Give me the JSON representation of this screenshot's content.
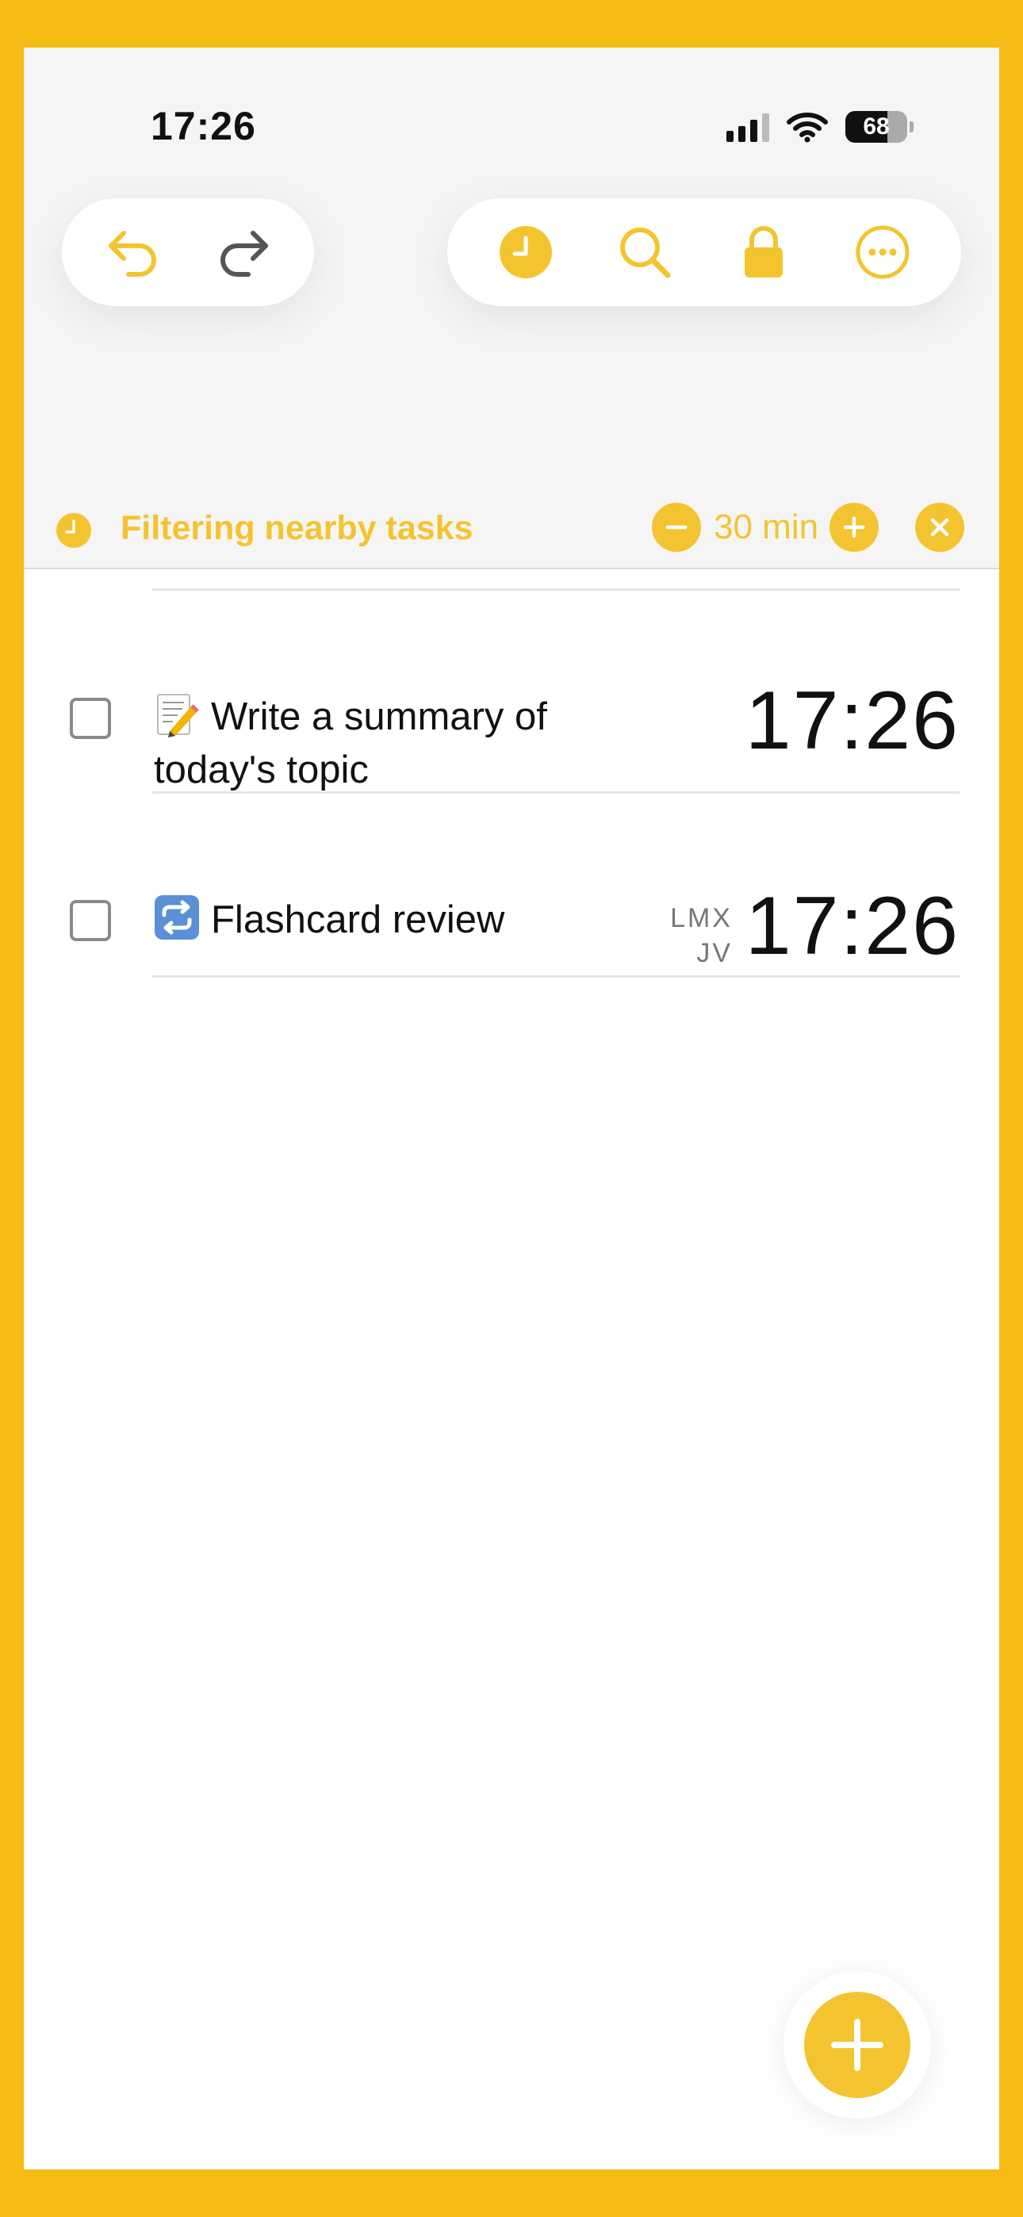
{
  "colors": {
    "accent": "#F4C430",
    "frame": "#F4BC14",
    "text": "#111111",
    "secondary_text": "#777777"
  },
  "status_bar": {
    "time": "17:26",
    "battery": "68",
    "icons": [
      "cellular-signal-icon",
      "wifi-icon",
      "battery-icon"
    ]
  },
  "toolbar": {
    "left_icons": [
      "undo-icon",
      "redo-icon"
    ],
    "right_icons": [
      "clock-icon",
      "search-icon",
      "lock-icon",
      "more-icon"
    ]
  },
  "filter": {
    "label": "Filtering nearby tasks",
    "minutes": "30 min",
    "icons": [
      "clock-icon",
      "minus-icon",
      "plus-icon",
      "close-icon"
    ]
  },
  "tasks": [
    {
      "emoji_icon": "memo-icon",
      "title": "Write a summary of today's topic",
      "time": "17:26",
      "repeat_days": [
        "",
        ""
      ]
    },
    {
      "emoji_icon": "repeat-icon",
      "title": "Flashcard review",
      "time": "17:26",
      "repeat_days": [
        "LMX",
        "JV"
      ]
    }
  ],
  "fab": {
    "icon": "plus-icon"
  }
}
